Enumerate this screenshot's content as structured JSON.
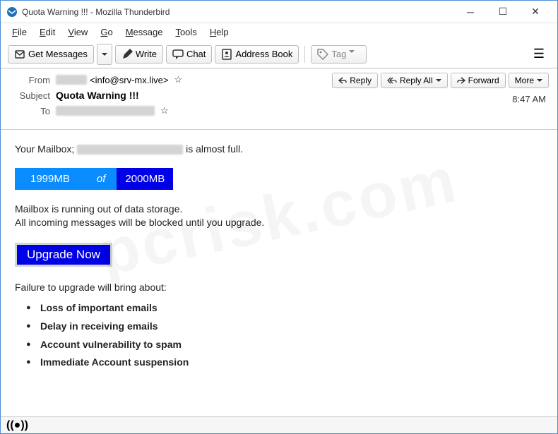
{
  "window": {
    "title": "Quota Warning !!! - Mozilla Thunderbird"
  },
  "menubar": {
    "file": "File",
    "edit": "Edit",
    "view": "View",
    "go": "Go",
    "message": "Message",
    "tools": "Tools",
    "help": "Help"
  },
  "toolbar": {
    "get_messages": "Get Messages",
    "write": "Write",
    "chat": "Chat",
    "address_book": "Address Book",
    "tag": "Tag"
  },
  "headers": {
    "from_label": "From",
    "from_email": "<info@srv-mx.live>",
    "subject_label": "Subject",
    "subject_value": "Quota Warning !!!",
    "to_label": "To",
    "timestamp": "8:47 AM"
  },
  "actions": {
    "reply": "Reply",
    "reply_all": "Reply All",
    "forward": "Forward",
    "more": "More"
  },
  "body": {
    "mailbox_prefix": "Your Mailbox; ",
    "mailbox_suffix": " is almost full.",
    "quota_used": "1999MB",
    "quota_of": "of",
    "quota_total": "2000MB",
    "line1": "Mailbox is running out of data storage.",
    "line2": "All incoming messages will be blocked until you upgrade.",
    "upgrade_label": "Upgrade Now",
    "failure_intro": "Failure to upgrade will bring about:",
    "bullets": [
      "Loss of important emails",
      "Delay in receiving emails",
      "Account vulnerability to spam",
      "Immediate Account suspension"
    ]
  },
  "watermark": "pcrisk.com"
}
